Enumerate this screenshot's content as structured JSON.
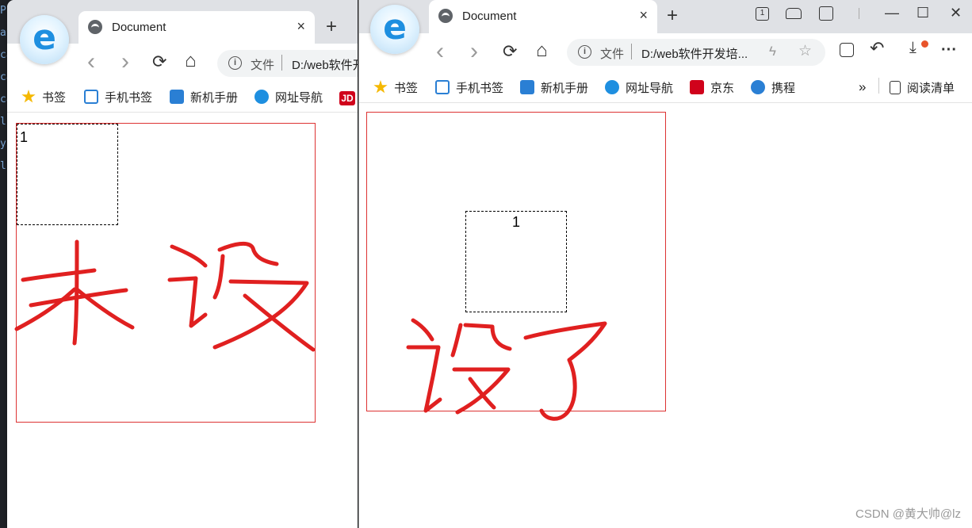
{
  "editor_strip": [
    "PE",
    "ar",
    "",
    "",
    "ca",
    "ca",
    "ca",
    "l",
    "y",
    "l",
    "",
    "",
    "",
    "",
    "",
    "",
    "",
    "",
    "",
    "",
    "y"
  ],
  "left_window": {
    "tab_title": "Document",
    "tab_close": "×",
    "new_tab": "+",
    "back": "‹",
    "forward": "›",
    "refresh": "⟳",
    "home": "⌂",
    "address": {
      "info": "i",
      "scheme": "文件",
      "url": "D:/web软件开发培"
    },
    "bookmarks": [
      "书签",
      "手机书签",
      "新机手册",
      "网址导航",
      "JD"
    ],
    "box_number": "1",
    "annotation": "未设"
  },
  "right_window": {
    "tab_title": "Document",
    "tab_close": "×",
    "new_tab": "+",
    "back": "‹",
    "forward": "›",
    "refresh": "⟳",
    "home": "⌂",
    "address": {
      "info": "i",
      "scheme": "文件",
      "url": "D:/web软件开发培..."
    },
    "bookmarks": [
      "书签",
      "手机书签",
      "新机手册",
      "网址导航",
      "京东",
      "携程"
    ],
    "more_bookmarks": "»",
    "reading_list": "阅读清单",
    "box_number": "1",
    "annotation": "设了",
    "window_controls": {
      "minimize": "—",
      "maximize": "☐",
      "close": "✕"
    },
    "menu_more": "···"
  },
  "watermark": "CSDN @黄大帅@lz",
  "colors": {
    "border_red": "#dd3333",
    "annotation_red": "#e02020",
    "edge_blue": "#1e8fe0"
  }
}
